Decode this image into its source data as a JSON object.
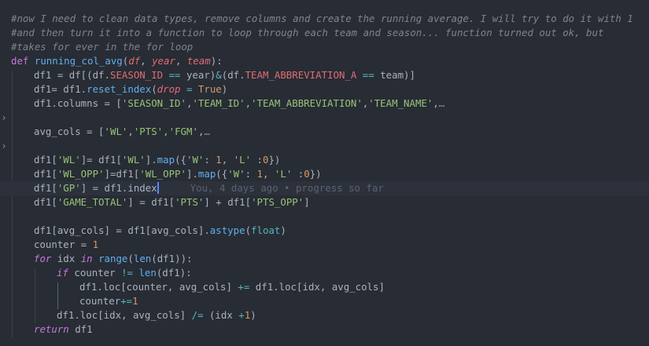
{
  "editor": {
    "theme_colors": {
      "background": "#282c34",
      "comment": "#7f848e",
      "keyword": "#c678dd",
      "function": "#61afef",
      "parameter": "#e06c75",
      "string": "#98c379",
      "number": "#d19a66",
      "operator": "#56b6c2",
      "cursor": "#528bff"
    },
    "fold_icons": {
      "collapsed": "chevron-right-icon"
    },
    "code": {
      "comment1": "#now I need to clean data types, remove columns and create the running average. I will try to do it with 1",
      "comment2": "#and then turn it into a function to loop through each team and season... function turned out ok, but",
      "comment3": "#takes for ever in the for loop",
      "def_kw": "def",
      "func_name": "running_col_avg",
      "p_open": "(",
      "param_df": "df",
      "param_year": "year",
      "param_team": "team",
      "comma_sp": ", ",
      "p_close_colon": "):",
      "l5_a": "df1 = df[(df.",
      "l5_f1": "SEASON_ID",
      "l5_op1": " == ",
      "l5_b": "year)",
      "l5_amp": "&",
      "l5_c": "(df.",
      "l5_f2": "TEAM_ABBREVIATION_A",
      "l5_op2": " == ",
      "l5_d": "team)]",
      "l6_a": "df1= df1.",
      "l6_fn": "reset_index",
      "l6_p": "(",
      "l6_par": "drop",
      "l6_eq": " = ",
      "l6_true": "True",
      "l6_end": ")",
      "l7_a": "df1.columns = [",
      "l7_s1": "'SEASON_ID'",
      "l7_s2": "'TEAM_ID'",
      "l7_s3": "'TEAM_ABBREVIATION'",
      "l7_s4": "'TEAM_NAME'",
      "comma": ",",
      "ellipsis": "…",
      "l9_a": "avg_cols = [",
      "l9_s1": "'WL'",
      "l9_s2": "'PTS'",
      "l9_s3": "'FGM'",
      "l11_a": "df1[",
      "l11_s1": "'WL'",
      "l11_b": "]= df1[",
      "l11_s2": "'WL'",
      "l11_c": "].",
      "l11_fn": "map",
      "l11_d": "({",
      "l11_s3": "'W'",
      "l11_e": ": ",
      "l11_n1": "1",
      "l11_f": ", ",
      "l11_s4": "'L'",
      "l11_g": " :",
      "l11_n2": "0",
      "l11_h": "})",
      "l12_a": "df1[",
      "l12_s1": "'WL_OPP'",
      "l12_b": "]=df1[",
      "l12_s2": "'WL_OPP'",
      "l12_c": "].",
      "l12_fn": "map",
      "l12_d": "({",
      "l12_s3": "'W'",
      "l12_e": ": ",
      "l12_n1": "1",
      "l12_f": ", ",
      "l12_s4": "'L'",
      "l12_g": " :",
      "l12_n2": "0",
      "l12_h": "})",
      "l13_a": "df1[",
      "l13_s1": "'GP'",
      "l13_b": "] = df1.index",
      "l13_blame": "You, 4 days ago • progress so far",
      "l14_a": "df1[",
      "l14_s1": "'GAME_TOTAL'",
      "l14_b": "] = df1[",
      "l14_s2": "'PTS'",
      "l14_c": "] + df1[",
      "l14_s3": "'PTS_OPP'",
      "l14_d": "]",
      "l16_a": "df1[avg_cols] = df1[avg_cols].",
      "l16_fn": "astype",
      "l16_p": "(",
      "l16_bi": "float",
      "l16_e": ")",
      "l17_a": "counter = ",
      "l17_n": "1",
      "l18_kw1": "for",
      "l18_a": " idx ",
      "l18_kw2": "in",
      "l18_sp": " ",
      "l18_fn1": "range",
      "l18_p1": "(",
      "l18_fn2": "len",
      "l18_b": "(df1)):",
      "l19_kw": "if",
      "l19_a": " counter ",
      "l19_op": "!=",
      "l19_sp": " ",
      "l19_fn": "len",
      "l19_b": "(df1):",
      "l20_a": "df1.loc[counter, avg_cols] ",
      "l20_op": "+=",
      "l20_b": " df1.loc[idx, avg_cols]",
      "l21_a": "counter",
      "l21_op": "+=",
      "l21_n": "1",
      "l22_a": "df1.loc[idx, avg_cols] ",
      "l22_op": "/=",
      "l22_b": " (idx ",
      "l22_op2": "+",
      "l22_n": "1",
      "l22_c": ")",
      "l23_kw": "return",
      "l23_a": " df1"
    }
  }
}
